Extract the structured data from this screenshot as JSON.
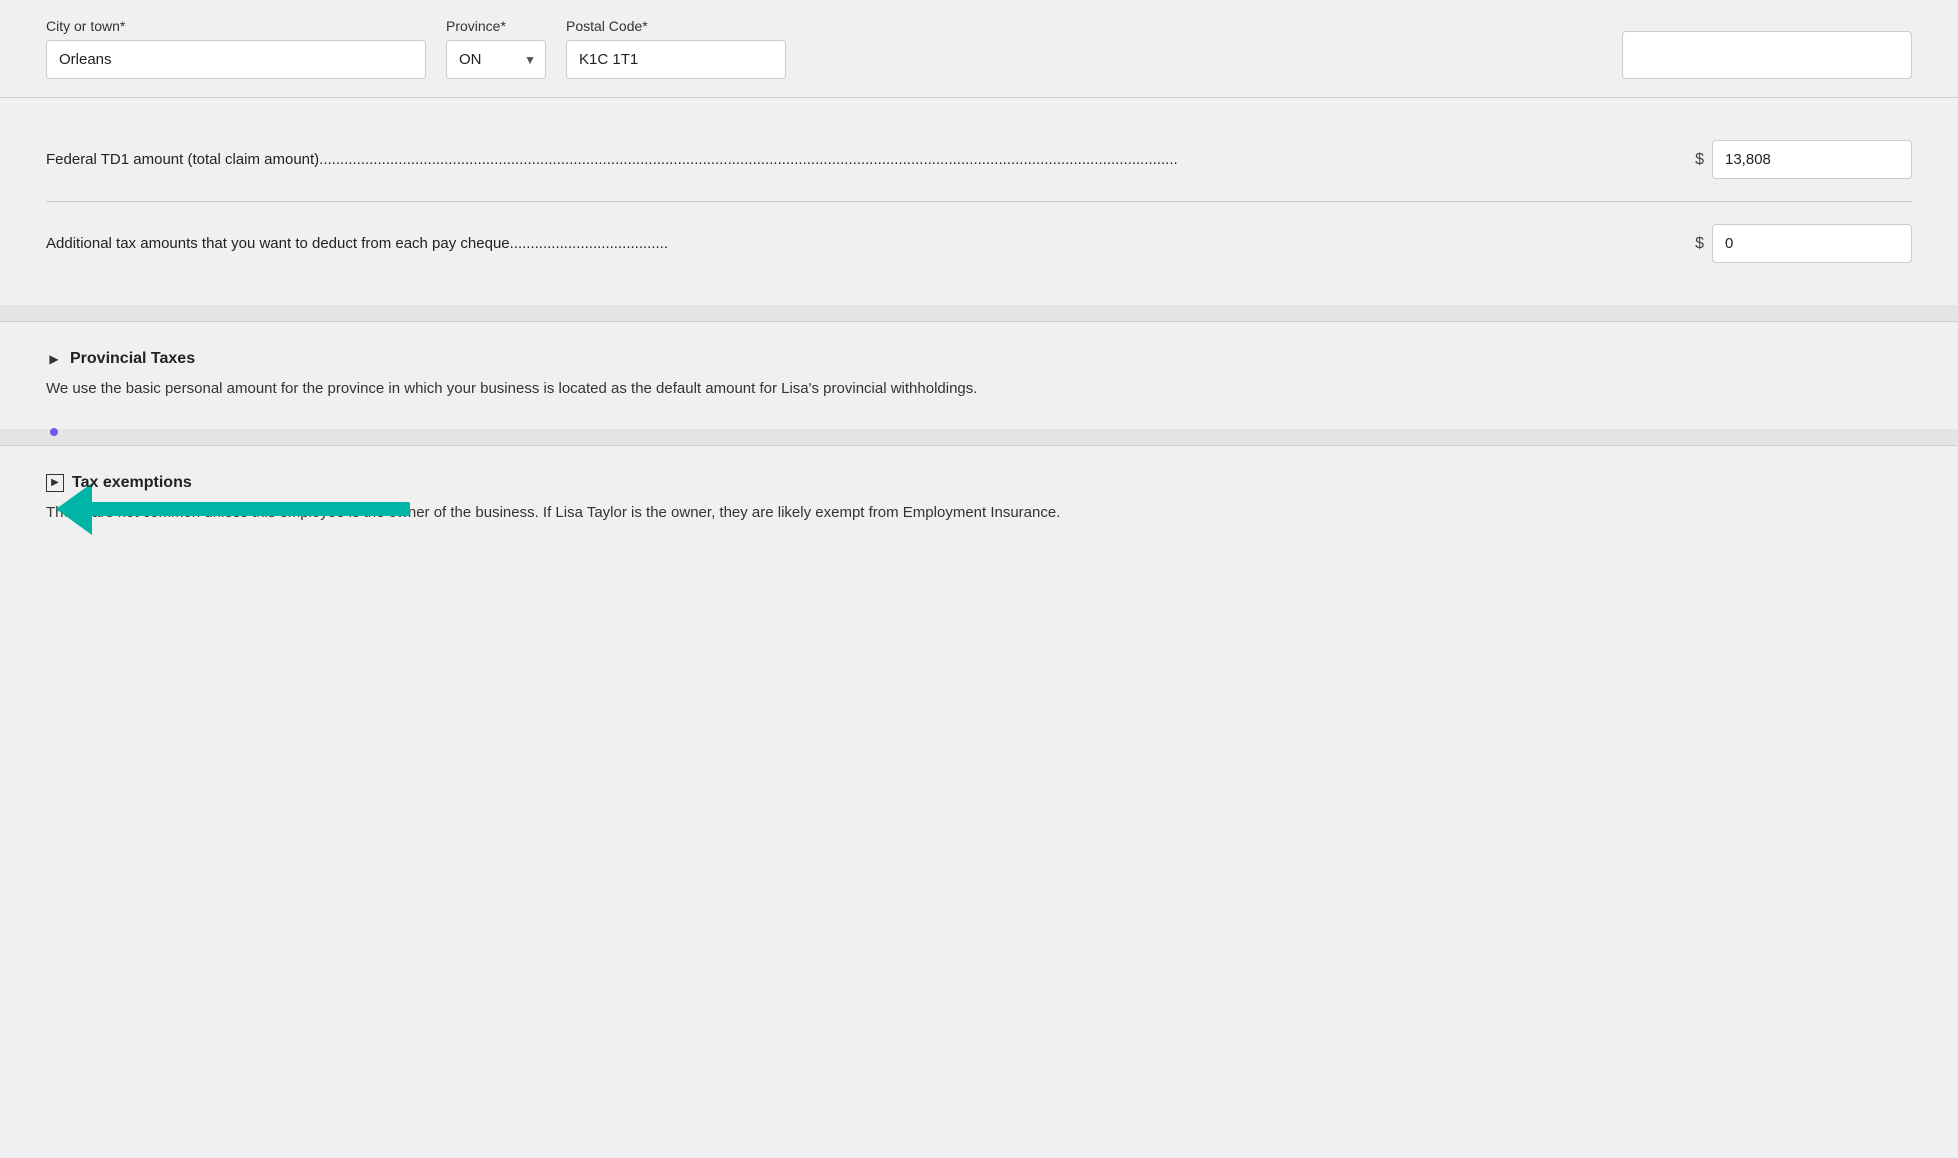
{
  "address": {
    "city_label": "City or town*",
    "city_value": "Orleans",
    "province_label": "Province*",
    "province_value": "ON",
    "postal_label": "Postal Code*",
    "postal_value": "K1C 1T1"
  },
  "federal": {
    "td1_label": "Federal TD1 amount (total claim amount).                                                                                                                                                                                     ",
    "td1_dots": "Federal TD1 amount (total claim amount)",
    "td1_value": "13,808",
    "additional_label": "Additional tax amounts that you want to deduct from each pay cheque",
    "additional_value": "0",
    "dollar_sign": "$"
  },
  "provincial": {
    "toggle": "▶",
    "title": "Provincial Taxes",
    "description": "We use the basic personal amount for the province in which your business is located as the default amount for Lisa's provincial withholdings."
  },
  "tax_exemptions": {
    "toggle": "▶",
    "title": "Tax exemptions",
    "description": "These are not common unless this employee is the owner of the business. If Lisa Taylor is the owner, they are likely exempt from Employment Insurance."
  },
  "colors": {
    "arrow": "#00b5a5",
    "dot": "#6b5ce7",
    "background": "#f0f0f0",
    "divider": "#d0d0d0"
  }
}
